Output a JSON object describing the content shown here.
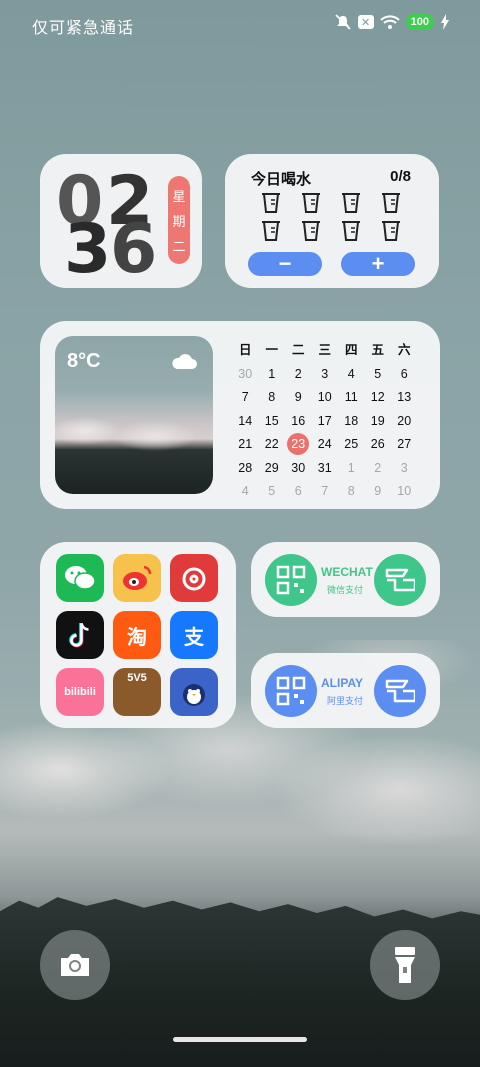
{
  "status": {
    "carrier": "仅可紧急通话",
    "battery": "100"
  },
  "clock": {
    "digits": [
      "0",
      "2",
      "3",
      "6"
    ],
    "weekday_chars": [
      "星",
      "期",
      "二"
    ]
  },
  "water": {
    "title": "今日喝水",
    "count": "0/8",
    "minus_label": "−",
    "plus_label": "+"
  },
  "weather": {
    "temp": "8°C",
    "icon": "cloud-icon"
  },
  "calendar": {
    "headers": [
      "日",
      "一",
      "二",
      "三",
      "四",
      "五",
      "六"
    ],
    "rows": [
      [
        "30",
        "1",
        "2",
        "3",
        "4",
        "5",
        "6"
      ],
      [
        "7",
        "8",
        "9",
        "10",
        "11",
        "12",
        "13"
      ],
      [
        "14",
        "15",
        "16",
        "17",
        "18",
        "19",
        "20"
      ],
      [
        "21",
        "22",
        "23",
        "24",
        "25",
        "26",
        "27"
      ],
      [
        "28",
        "29",
        "30",
        "31",
        "1",
        "2",
        "3"
      ],
      [
        "4",
        "5",
        "6",
        "7",
        "8",
        "9",
        "10"
      ]
    ],
    "today": "23"
  },
  "apps": [
    {
      "name": "wechat",
      "label": "",
      "color": "#1db954"
    },
    {
      "name": "weibo",
      "label": "",
      "color": "#f6c24b"
    },
    {
      "name": "netease-music",
      "label": "",
      "color": "#e03a3a"
    },
    {
      "name": "douyin",
      "label": "",
      "color": "#111111"
    },
    {
      "name": "taobao",
      "label": "淘",
      "color": "#ff5a12"
    },
    {
      "name": "alipay",
      "label": "支",
      "color": "#1677ff"
    },
    {
      "name": "bilibili",
      "label": "bilibili",
      "color": "#fb7299"
    },
    {
      "name": "honor-of-kings",
      "label": "5V5",
      "color": "#8a5a2a"
    },
    {
      "name": "game-penguin",
      "label": "",
      "color": "#3b63c8"
    }
  ],
  "wechat_pay": {
    "title": "WECHAT",
    "subtitle": "微信支付",
    "color": "#3fc68a"
  },
  "alipay_pay": {
    "title": "ALIPAY",
    "subtitle": "阿里支付",
    "color": "#5b8ef0"
  },
  "accent": {
    "today": "#e9726d",
    "weekday": "#ef7772",
    "water_button": "#5b8ef0"
  }
}
